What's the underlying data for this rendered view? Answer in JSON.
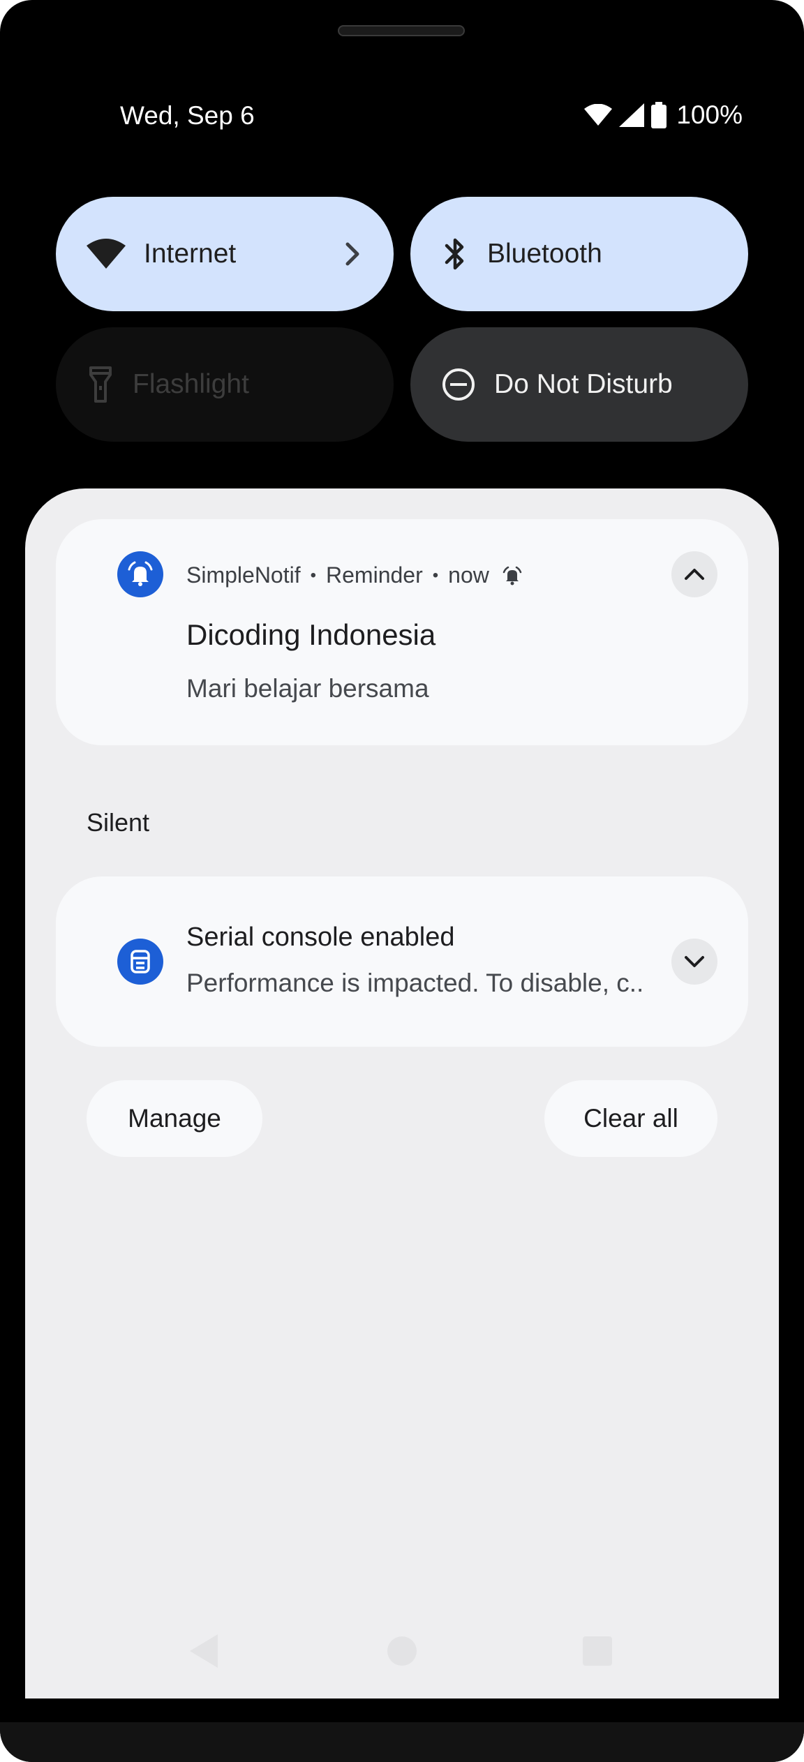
{
  "status_bar": {
    "date": "Wed, Sep 6",
    "battery_percent": "100%"
  },
  "quick_tiles": [
    {
      "label": "Internet",
      "icon": "wifi-icon",
      "state": "on"
    },
    {
      "label": "Bluetooth",
      "icon": "bluetooth-icon",
      "state": "on"
    },
    {
      "label": "Flashlight",
      "icon": "flashlight-icon",
      "state": "unavailable"
    },
    {
      "label": "Do Not Disturb",
      "icon": "do-not-disturb-icon",
      "state": "off"
    }
  ],
  "notifications": {
    "reminder": {
      "app_name": "SimpleNotif",
      "channel": "Reminder",
      "time": "now",
      "title": "Dicoding Indonesia",
      "text": "Mari belajar bersama",
      "app_icon": "alarm-bell-icon",
      "expanded": true
    },
    "section_label": "Silent",
    "serial": {
      "title": "Serial console enabled",
      "text": "Performance is impacted. To disable, c..",
      "app_icon": "serial-console-icon",
      "expanded": false
    }
  },
  "actions": {
    "manage": "Manage",
    "clear_all": "Clear all"
  },
  "colors": {
    "tile_on": "#d3e3fd",
    "tile_off": "#303133",
    "app_badge": "#1d5fd6",
    "shade": "#eeeef0",
    "card": "#f8f9fb"
  }
}
